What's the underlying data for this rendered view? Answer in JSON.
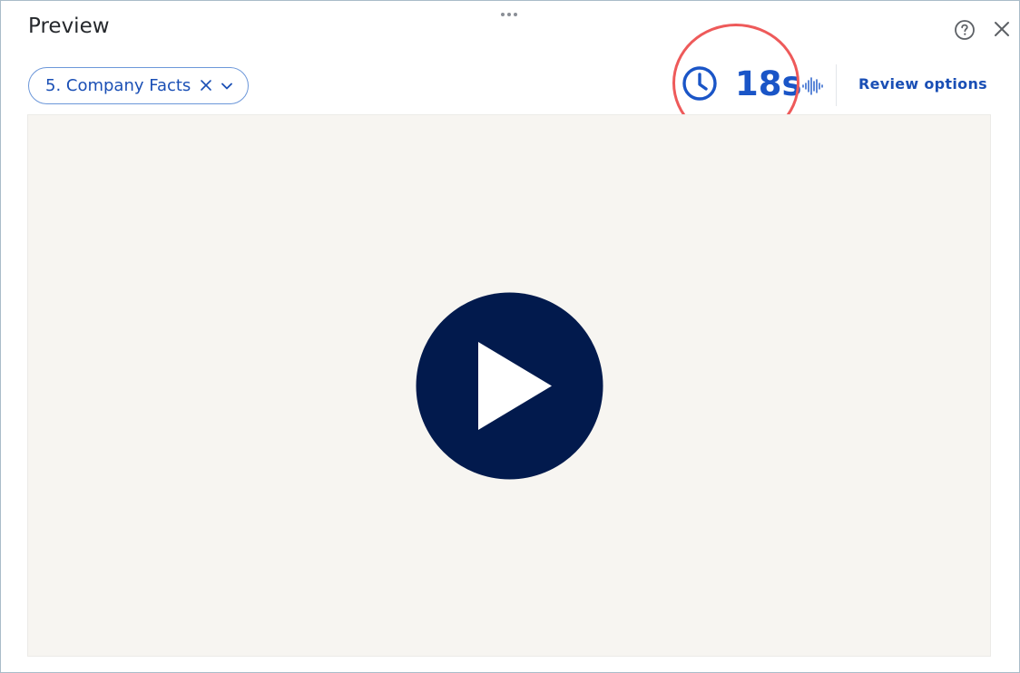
{
  "panel": {
    "title": "Preview"
  },
  "header": {
    "help_icon": "question-circle-icon",
    "close_icon": "close-icon",
    "drag_icon": "drag-handle-icon"
  },
  "selector": {
    "selected_value": "5. Company Facts",
    "clear_icon": "close-icon",
    "caret_icon": "chevron-down-icon"
  },
  "timer": {
    "icon": "clock-icon",
    "duration": "18s",
    "highlighted": true
  },
  "audio": {
    "icon": "waveform-icon"
  },
  "review": {
    "label": "Review options"
  },
  "player": {
    "icon": "play-icon"
  },
  "colors": {
    "accent": "#1a55c7",
    "link": "#1a4fb5",
    "player_button": "#021a4d",
    "stage_background": "#f7f5f1",
    "highlight": "#ee5a5a",
    "panel_border": "#a9bcc9"
  }
}
